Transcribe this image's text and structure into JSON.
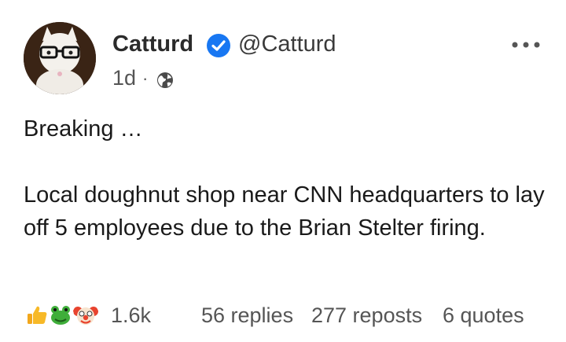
{
  "author": {
    "name": "Catturd",
    "handle": "@Catturd",
    "verified": true
  },
  "meta": {
    "time": "1d",
    "separator": "·",
    "audience_icon": "globe-icon"
  },
  "post": {
    "line1": "Breaking …",
    "line2": "Local doughnut shop near CNN headquarters to lay off 5 employees due to the Brian Stelter firing."
  },
  "engagement": {
    "reaction_icons": [
      "thumbs-up-icon",
      "frog-icon",
      "clown-icon"
    ],
    "reaction_count": "1.6k",
    "replies": "56 replies",
    "reposts": "277 reposts",
    "quotes": "6 quotes"
  },
  "colors": {
    "verified": "#1877f2",
    "text": "#1a1a1a",
    "secondary": "#555555"
  }
}
